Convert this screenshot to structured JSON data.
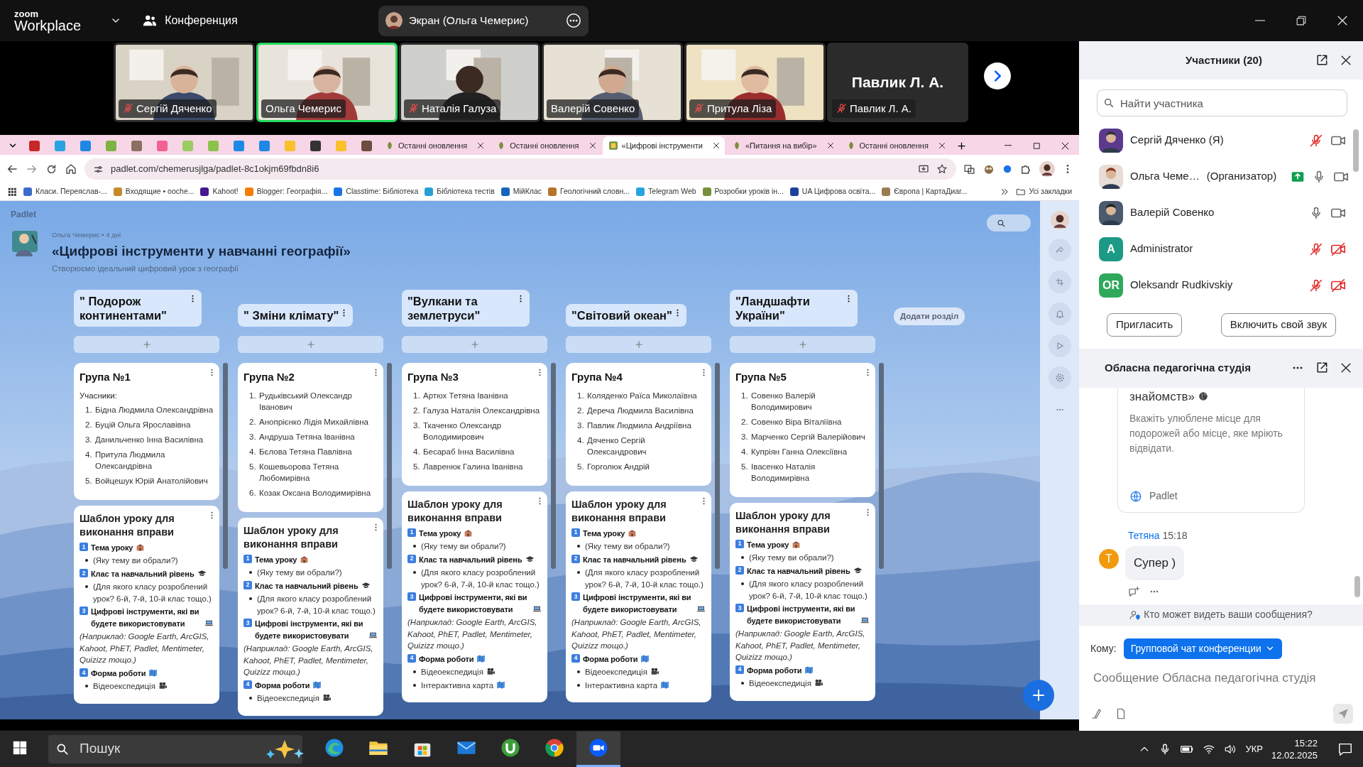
{
  "zoom_bar": {
    "logo_top": "zoom",
    "logo_bottom": "Workplace",
    "meeting": "Конференция",
    "share": "Экран (Ольга Чемерис)"
  },
  "videos": [
    {
      "name": "Сергій Дяченко",
      "muted": true,
      "selected": false,
      "video_off": false
    },
    {
      "name": "Ольга Чемерис",
      "muted": false,
      "selected": true,
      "video_off": false
    },
    {
      "name": "Наталія Галуза",
      "muted": true,
      "selected": false,
      "video_off": false
    },
    {
      "name": "Валерій Совенко",
      "muted": false,
      "selected": false,
      "video_off": false
    },
    {
      "name": "Притула Ліза",
      "muted": true,
      "selected": false,
      "video_off": false
    },
    {
      "name": "Павлик Л. А.",
      "muted": true,
      "selected": false,
      "video_off": true,
      "display_name": "Павлик Л. А."
    }
  ],
  "browser": {
    "tabs": [
      {
        "kind": "pinned",
        "selected": false
      },
      {
        "kind": "pinned",
        "selected": false
      },
      {
        "kind": "pinned",
        "selected": false
      },
      {
        "kind": "pinned",
        "selected": false
      },
      {
        "kind": "pinned",
        "selected": false
      },
      {
        "kind": "pinned",
        "selected": false
      },
      {
        "kind": "pinned",
        "selected": false
      },
      {
        "kind": "pinned",
        "selected": false
      },
      {
        "kind": "pinned",
        "selected": false
      },
      {
        "kind": "pinned",
        "selected": false
      },
      {
        "kind": "pinned",
        "selected": false
      },
      {
        "kind": "pinned",
        "selected": false
      },
      {
        "kind": "pinned",
        "selected": false
      },
      {
        "kind": "pinned",
        "selected": false
      },
      {
        "kind": "page",
        "label": "Останні оновлення",
        "selected": false
      },
      {
        "kind": "page",
        "label": "Останні оновлення",
        "selected": false
      },
      {
        "kind": "page",
        "label": "«Цифрові інструменти",
        "selected": true
      },
      {
        "kind": "page",
        "label": "«Питання на вибір»",
        "selected": false
      },
      {
        "kind": "page",
        "label": "Останні оновлення",
        "selected": false
      }
    ],
    "url": "padlet.com/chemerusjlga/padlet-8c1okjm69fbdn8i6",
    "bookmarks": [
      "Класи. Переяслав-...",
      "Входящие • ooche...",
      "Kahoot!",
      "Blogger: Географія...",
      "Classtime: Бібліотека",
      "Бібліотека тестів",
      "МійКлас",
      "Геологічний словн...",
      "Telegram Web",
      "Розробки уроків ін...",
      "UA Цифрова освіта...",
      "Європа | КартаДиаг..."
    ],
    "all_bookmarks": "Усі закладки"
  },
  "padlet": {
    "brand": "Padlet",
    "author": "Ольга Чемерис • 4 дні",
    "title": "«Цифрові інструменти у навчанні географії»",
    "subtitle": "Створюємо ідеальний цифровий урок з географії",
    "add_section": "Додати розділ",
    "sections": [
      {
        "title": "\" Подорож континентами\"",
        "posts": [
          {
            "kind": "list",
            "title": "Група №1",
            "intro": "Учасники:",
            "items": [
              {
                "num": "1.",
                "text": "Бідна Людмила Олександрівна"
              },
              {
                "num": "2.",
                "text": "Буцій Ольга Ярославівна"
              },
              {
                "num": "3.",
                "text": "Данильченко Інна Василівна"
              },
              {
                "num": "4.",
                "text": "Притула Людмила Олександрівна"
              },
              {
                "num": "5.",
                "text": "Войцешук Юрій Анатолійович"
              }
            ]
          },
          {
            "kind": "template",
            "title": "Шаблон уроку для виконання вправи",
            "blocks": [
              {
                "kind": "heading",
                "num": "1",
                "text": "Тема уроку"
              },
              {
                "kind": "bullet",
                "text": "(Яку тему ви обрали?)"
              },
              {
                "kind": "heading",
                "num": "2",
                "text": "Клас та навчальний рівень"
              },
              {
                "kind": "bullet",
                "text": "(Для якого класу розроблений урок? 6-й, 7-й, 10-й клас тощо.)"
              },
              {
                "kind": "heading",
                "num": "3",
                "text": "Цифрові інструменти, які ви будете використовувати"
              },
              {
                "kind": "note",
                "text": "(Наприклад: Google Earth, ArcGIS, Kahoot, PhET, Padlet, Mentimeter, Quizizz тощо.)"
              },
              {
                "kind": "heading",
                "num": "4",
                "text": "Форма роботи"
              },
              {
                "kind": "bullet",
                "text": "Відеоекспедиція"
              }
            ]
          }
        ]
      },
      {
        "title": "\" Зміни клімату\"",
        "posts": [
          {
            "kind": "list",
            "title": "Група №2",
            "items": [
              {
                "num": "1.",
                "text": "Рудьківський Олександр Іванович"
              },
              {
                "num": "2.",
                "text": "Анопрієнко Лідія Михайлівна"
              },
              {
                "num": "3.",
                "text": "Андруша Тетяна Іванівна"
              },
              {
                "num": "4.",
                "text": "Бєлова Тетяна Павлівна"
              },
              {
                "num": "5.",
                "text": "Кошевьорова Тетяна Любомирівна"
              },
              {
                "num": "6.",
                "text": "Козак Оксана Володимирівна"
              }
            ]
          },
          {
            "kind": "template",
            "title": "Шаблон уроку для виконання вправи",
            "blocks": [
              {
                "kind": "heading",
                "num": "1",
                "text": "Тема уроку"
              },
              {
                "kind": "bullet",
                "text": "(Яку тему ви обрали?)"
              },
              {
                "kind": "heading",
                "num": "2",
                "text": "Клас та навчальний рівень"
              },
              {
                "kind": "bullet",
                "text": "(Для якого класу розроблений урок? 6-й, 7-й, 10-й клас тощо.)"
              },
              {
                "kind": "heading",
                "num": "3",
                "text": "Цифрові інструменти, які ви будете використовувати"
              },
              {
                "kind": "note",
                "text": "(Наприклад: Google Earth, ArcGIS, Kahoot, PhET, Padlet, Mentimeter, Quizizz тощо.)"
              },
              {
                "kind": "heading",
                "num": "4",
                "text": "Форма роботи"
              },
              {
                "kind": "bullet",
                "text": "Відеоекспедиція"
              }
            ]
          }
        ]
      },
      {
        "title": "\"Вулкани та землетруси\"",
        "posts": [
          {
            "kind": "list",
            "title": "Група №3",
            "items": [
              {
                "num": "1.",
                "text": "Артюх Тетяна Іванівна"
              },
              {
                "num": "2.",
                "text": "Галуза Наталія Олександрівна"
              },
              {
                "num": "3.",
                "text": "Ткаченко Олександр Володимирович"
              },
              {
                "num": "4.",
                "text": "Бесараб Інна Василівна"
              },
              {
                "num": "5.",
                "text": "Лавренюк Галина Іванівна"
              }
            ]
          },
          {
            "kind": "template",
            "title": "Шаблон уроку для виконання вправи",
            "blocks": [
              {
                "kind": "heading",
                "num": "1",
                "text": "Тема уроку"
              },
              {
                "kind": "bullet",
                "text": "(Яку тему ви обрали?)"
              },
              {
                "kind": "heading",
                "num": "2",
                "text": "Клас та навчальний рівень"
              },
              {
                "kind": "bullet",
                "text": "(Для якого класу розроблений урок? 6-й, 7-й, 10-й клас тощо.)"
              },
              {
                "kind": "heading",
                "num": "3",
                "text": "Цифрові інструменти, які ви будете використовувати"
              },
              {
                "kind": "note",
                "text": "(Наприклад: Google Earth, ArcGIS, Kahoot, PhET, Padlet, Mentimeter, Quizizz тощо.)"
              },
              {
                "kind": "heading",
                "num": "4",
                "text": "Форма роботи"
              },
              {
                "kind": "bullet",
                "text": "Відеоекспедиція"
              },
              {
                "kind": "bullet",
                "text": "Інтерактивна карта"
              }
            ]
          }
        ]
      },
      {
        "title": "\"Світовий океан\"",
        "posts": [
          {
            "kind": "list",
            "title": "Група №4",
            "items": [
              {
                "num": "1.",
                "text": "Коляденко Раїса Миколаївна"
              },
              {
                "num": "2.",
                "text": "Дереча Людмила Василівна"
              },
              {
                "num": "3.",
                "text": "Павлик Людмила Андріївна"
              },
              {
                "num": "4.",
                "text": "Дяченко Сергій Олександрович"
              },
              {
                "num": "5.",
                "text": "Горголюк Андрій"
              }
            ]
          },
          {
            "kind": "template",
            "title": "Шаблон уроку для виконання вправи",
            "blocks": [
              {
                "kind": "heading",
                "num": "1",
                "text": "Тема уроку"
              },
              {
                "kind": "bullet",
                "text": "(Яку тему ви обрали?)"
              },
              {
                "kind": "heading",
                "num": "2",
                "text": "Клас та навчальний рівень"
              },
              {
                "kind": "bullet",
                "text": "(Для якого класу розроблений урок? 6-й, 7-й, 10-й клас тощо.)"
              },
              {
                "kind": "heading",
                "num": "3",
                "text": "Цифрові інструменти, які ви будете використовувати"
              },
              {
                "kind": "note",
                "text": "(Наприклад: Google Earth, ArcGIS, Kahoot, PhET, Padlet, Mentimeter, Quizizz тощо.)"
              },
              {
                "kind": "heading",
                "num": "4",
                "text": "Форма роботи"
              },
              {
                "kind": "bullet",
                "text": "Відеоекспедиція"
              },
              {
                "kind": "bullet",
                "text": "Інтерактивна карта"
              }
            ]
          }
        ]
      },
      {
        "title": "\"Ландшафти України\"",
        "posts": [
          {
            "kind": "list",
            "title": "Група №5",
            "items": [
              {
                "num": "1.",
                "text": "Совенко Валерій Володимирович"
              },
              {
                "num": "2.",
                "text": "Совенко Віра Віталіївна"
              },
              {
                "num": "3.",
                "text": "Марченко Сергій Валерійович"
              },
              {
                "num": "4.",
                "text": "Купріян Ганна Олексіївна"
              },
              {
                "num": "5.",
                "text": "Івасенко Наталія Володимирівна"
              }
            ]
          },
          {
            "kind": "template",
            "title": "Шаблон уроку для виконання вправи",
            "blocks": [
              {
                "kind": "heading",
                "num": "1",
                "text": "Тема уроку"
              },
              {
                "kind": "bullet",
                "text": "(Яку тему ви обрали?)"
              },
              {
                "kind": "heading",
                "num": "2",
                "text": "Клас та навчальний рівень"
              },
              {
                "kind": "bullet",
                "text": "(Для якого класу розроблений урок? 6-й, 7-й, 10-й клас тощо.)"
              },
              {
                "kind": "heading",
                "num": "3",
                "text": "Цифрові інструменти, які ви будете використовувати"
              },
              {
                "kind": "note",
                "text": "(Наприклад: Google Earth, ArcGIS, Kahoot, PhET, Padlet, Mentimeter, Quizizz тощо.)"
              },
              {
                "kind": "heading",
                "num": "4",
                "text": "Форма роботи"
              },
              {
                "kind": "bullet",
                "text": "Відеоекспедиція"
              }
            ]
          }
        ]
      }
    ]
  },
  "participants_panel": {
    "title": "Участники (20)",
    "search_placeholder": "Найти участника",
    "participants": [
      {
        "name": "Сергій Дяченко (Я)",
        "muted": true,
        "video_off": false,
        "sharing": false
      },
      {
        "name": "Ольга Чеме…",
        "role": "(Организатор)",
        "muted": false,
        "video_off": false,
        "sharing": true
      },
      {
        "name": "Валерій Совенко",
        "muted": false,
        "video_off": false,
        "sharing": false
      },
      {
        "name": "Administrator",
        "kind": "initials",
        "initials": "A",
        "color": "#1d9a86",
        "muted": true,
        "video_off": true,
        "sharing": false
      },
      {
        "name": "Oleksandr Rudkivskiy",
        "kind": "initials",
        "initials": "OR",
        "color": "#2ea95c",
        "muted": true,
        "video_off": true,
        "sharing": false
      }
    ],
    "buttons": [
      "Пригласить",
      "Включить свой звук"
    ]
  },
  "chat": {
    "title": "Обласна педагогічна студія",
    "preview": {
      "title_tail": "знайомств»",
      "text": "Вкажіть улюблене місце для подорожей або місце, яке мріють відвідати.",
      "site": "Padlet"
    },
    "messages": [
      {
        "sender": "Тетяна",
        "time": "15:18",
        "initial": "Т",
        "color": "#f29a0e",
        "text": "Супер )"
      }
    ],
    "privacy": "Кто может видеть ваши сообщения?",
    "to_label": "Кому:",
    "recipient": "Групповой чат конференции",
    "placeholder": "Сообщение Обласна педагогічна студія"
  },
  "taskbar": {
    "search_placeholder": "Пошук",
    "apps": [
      {
        "kind": "edge",
        "selected": false
      },
      {
        "kind": "folder",
        "selected": false
      },
      {
        "kind": "store",
        "selected": false
      },
      {
        "kind": "mail",
        "selected": false
      },
      {
        "kind": "torrent",
        "selected": false
      },
      {
        "kind": "chrome",
        "selected": false
      },
      {
        "kind": "zoom",
        "selected": true
      }
    ],
    "language": "УКР",
    "time": "15:22",
    "date": "12.02.2025"
  }
}
